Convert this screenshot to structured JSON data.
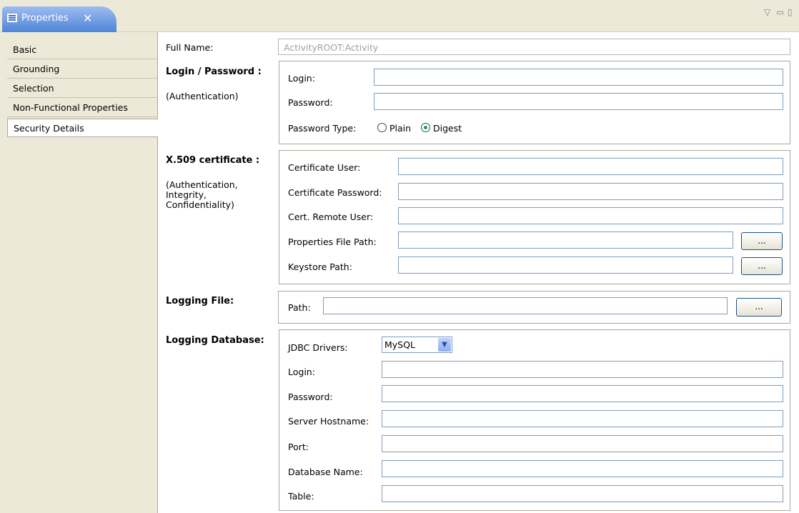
{
  "tab": {
    "title": "Properties",
    "close": "✕",
    "controls": [
      "▽",
      "▭",
      "▯"
    ]
  },
  "sidebar": {
    "items": [
      "Basic",
      "Grounding",
      "Selection",
      "Non-Functional Properties",
      "Security Details"
    ]
  },
  "form": {
    "full_name_label": "Full Name:",
    "full_name_value": "ActivityROOT:Activity",
    "login_section": {
      "title": "Login / Password :",
      "subtitle": "(Authentication)",
      "login_label": "Login:",
      "password_label": "Password:",
      "password_type_label": "Password Type:",
      "plain_label": "Plain",
      "digest_label": "Digest",
      "selected_type": "Digest"
    },
    "x509_section": {
      "title": "X.509 certificate :",
      "subtitle": "(Authentication, Integrity, Confidentiality)",
      "cert_user_label": "Certificate User:",
      "cert_password_label": "Certificate Password:",
      "cert_remote_user_label": "Cert. Remote User:",
      "properties_file_path_label": "Properties File Path:",
      "keystore_path_label": "Keystore Path:",
      "browse_label": "..."
    },
    "logging_file_section": {
      "title": "Logging File:",
      "path_label": "Path:",
      "browse_label": "..."
    },
    "logging_db_section": {
      "title": "Logging Database:",
      "jdbc_drivers_label": "JDBC Drivers:",
      "jdbc_driver_value": "MySQL",
      "login_label": "Login:",
      "password_label": "Password:",
      "server_hostname_label": "Server Hostname:",
      "port_label": "Port:",
      "database_name_label": "Database Name:",
      "table_label": "Table:"
    }
  }
}
